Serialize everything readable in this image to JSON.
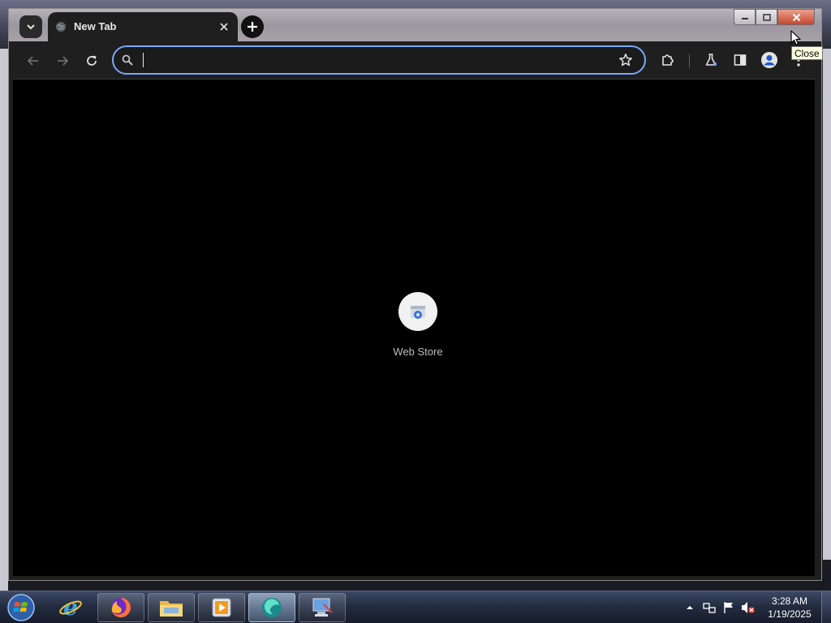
{
  "browser": {
    "tab": {
      "title": "New Tab"
    },
    "omnibox": {
      "value": "",
      "placeholder": ""
    },
    "shortcuts": [
      {
        "label": "Web Store"
      }
    ],
    "tooltip": "Close"
  },
  "taskbar": {
    "clock": {
      "time": "3:28 AM",
      "date": "1/19/2025"
    },
    "items": [
      {
        "name": "internet-explorer"
      },
      {
        "name": "firefox"
      },
      {
        "name": "file-explorer"
      },
      {
        "name": "media-player"
      },
      {
        "name": "chrome-like-app"
      },
      {
        "name": "remote-desktop"
      }
    ]
  },
  "colors": {
    "accent": "#7aa7f7",
    "page_background": "#000000",
    "toolbar": "#1f1f1f",
    "close_button": "#c8452c"
  }
}
